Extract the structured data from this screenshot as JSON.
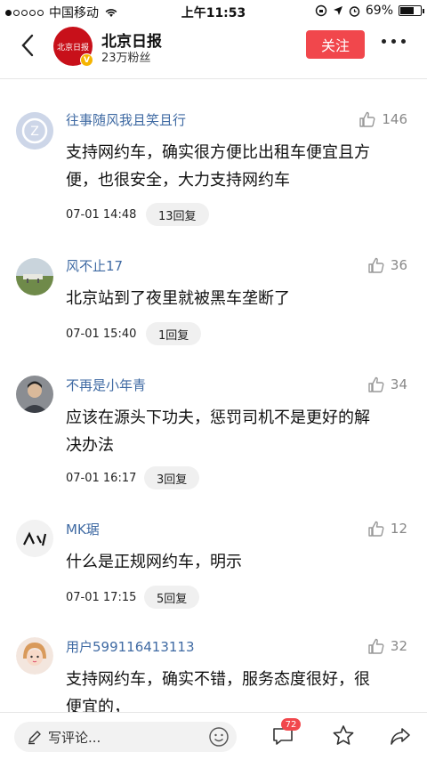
{
  "status_bar": {
    "carrier": "中国移动",
    "time": "上午11:53",
    "battery_percent": "69%",
    "battery_level": 0.69,
    "icons": [
      "signal-dots",
      "wifi",
      "rotation-lock",
      "location-arrow",
      "alarm-clock",
      "battery"
    ]
  },
  "header": {
    "account_name": "北京日报",
    "followers": "23万粉丝",
    "logo_text": "北京日报",
    "verified_mark": "V",
    "follow_label": "关注",
    "follow_color": "#f1474c"
  },
  "comments": [
    {
      "user": "往事随风我且笑且行",
      "likes": "146",
      "text_lines": [
        "支持网约车，确实很方便比出租车便宜且方",
        "便，也很安全，大力支持网约车"
      ],
      "time": "07-01 14:48",
      "replies": "13回复",
      "avatar": "default-gray-avatar"
    },
    {
      "user": "风不止17",
      "likes": "36",
      "text_lines": [
        "北京站到了夜里就被黑车垄断了"
      ],
      "time": "07-01 15:40",
      "replies": "1回复",
      "avatar": "landscape-photo-avatar"
    },
    {
      "user": "不再是小年青",
      "likes": "34",
      "text_lines": [
        "应该在源头下功夫，惩罚司机不是更好的解",
        "决办法"
      ],
      "time": "07-01 16:17",
      "replies": "3回复",
      "avatar": "person-photo-avatar"
    },
    {
      "user": "MK琚",
      "likes": "12",
      "text_lines": [
        "什么是正规网约车，明示"
      ],
      "time": "07-01 17:15",
      "replies": "5回复",
      "avatar": "sketch-face-avatar"
    },
    {
      "user": "用户599116413113",
      "likes": "32",
      "text_lines": [
        "支持网约车，确实不错，服务态度很好，很",
        "便宜的，"
      ],
      "time": "",
      "replies": "",
      "avatar": "cartoon-girl-avatar"
    }
  ],
  "bottom_bar": {
    "write_placeholder": "写评论...",
    "comment_count_badge": "72",
    "icons": [
      "pen-icon",
      "emoji-icon",
      "comment-icon",
      "star-icon",
      "share-icon"
    ]
  },
  "colors": {
    "username": "#3f6aa3",
    "accent": "#f1474c",
    "reply_bg": "#f0f0f0"
  }
}
